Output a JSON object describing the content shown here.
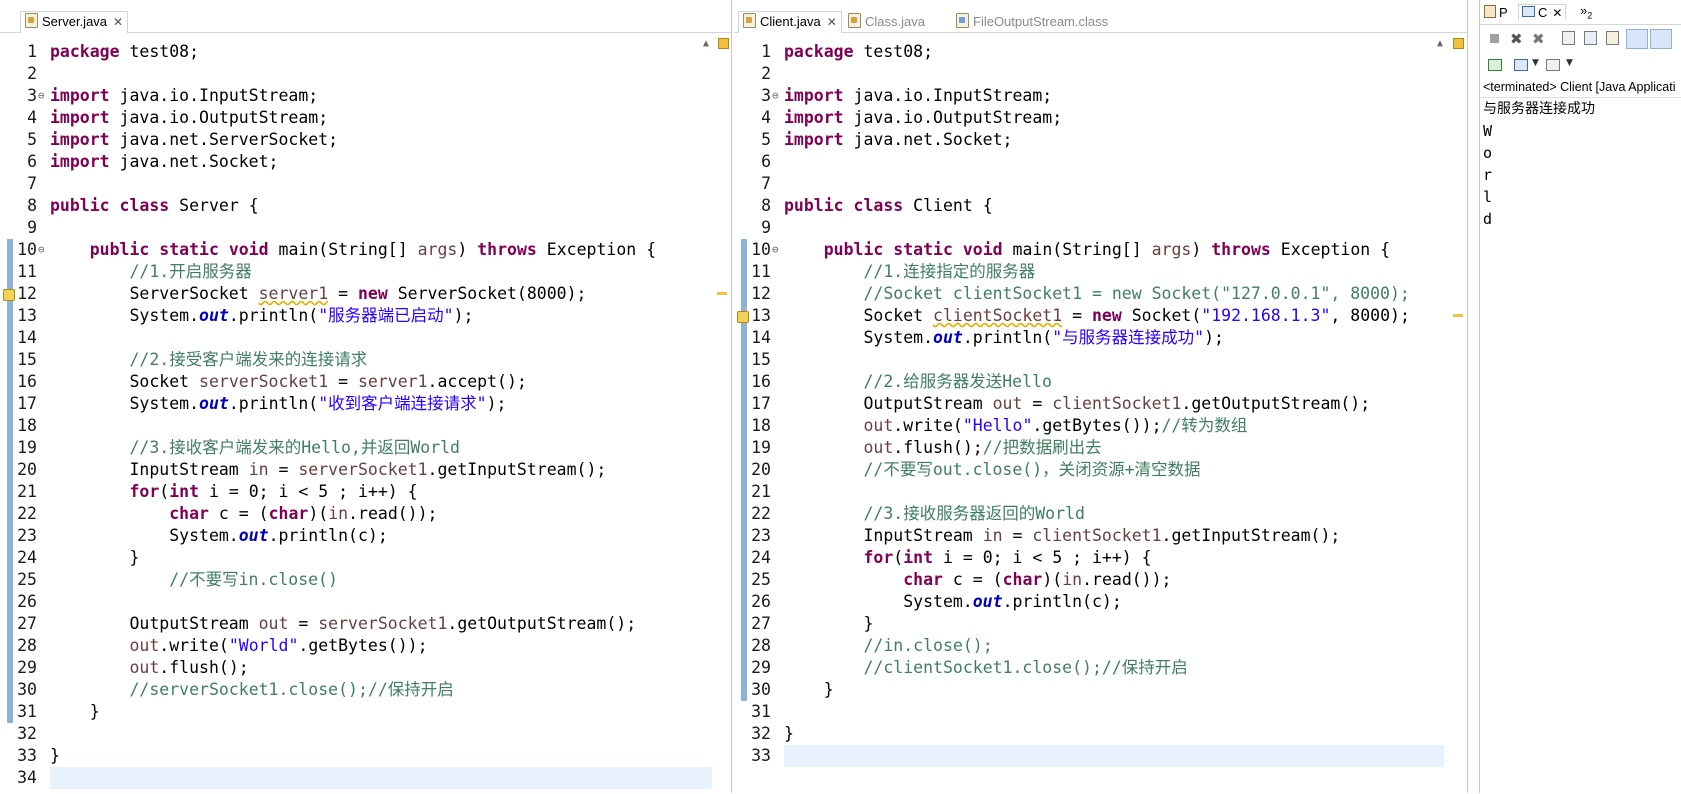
{
  "left_editor": {
    "tabs": [
      {
        "label": "Server.java",
        "active": true
      }
    ],
    "lines": [
      [
        [
          "kw",
          "package"
        ],
        [
          "p",
          " test08;"
        ]
      ],
      [],
      [
        [
          "kw",
          "import"
        ],
        [
          "p",
          " java.io.InputStream;"
        ]
      ],
      [
        [
          "kw",
          "import"
        ],
        [
          "p",
          " java.io.OutputStream;"
        ]
      ],
      [
        [
          "kw",
          "import"
        ],
        [
          "p",
          " java.net.ServerSocket;"
        ]
      ],
      [
        [
          "kw",
          "import"
        ],
        [
          "p",
          " java.net.Socket;"
        ]
      ],
      [],
      [
        [
          "kw",
          "public"
        ],
        [
          "p",
          " "
        ],
        [
          "kw",
          "class"
        ],
        [
          "p",
          " Server {"
        ]
      ],
      [],
      [
        [
          "p",
          "    "
        ],
        [
          "kw",
          "public"
        ],
        [
          "p",
          " "
        ],
        [
          "kw",
          "static"
        ],
        [
          "p",
          " "
        ],
        [
          "kw",
          "void"
        ],
        [
          "p",
          " main(String[] "
        ],
        [
          "var",
          "args"
        ],
        [
          "p",
          ") "
        ],
        [
          "kw",
          "throws"
        ],
        [
          "p",
          " Exception {"
        ]
      ],
      [
        [
          "p",
          "        "
        ],
        [
          "cm",
          "//1.开启服务器"
        ]
      ],
      [
        [
          "p",
          "        ServerSocket "
        ],
        [
          "warnvar",
          "server1"
        ],
        [
          "p",
          " = "
        ],
        [
          "kw",
          "new"
        ],
        [
          "p",
          " ServerSocket(8000);"
        ]
      ],
      [
        [
          "p",
          "        System."
        ],
        [
          "fld",
          "out"
        ],
        [
          "p",
          ".println("
        ],
        [
          "str",
          "\"服务器端已启动\""
        ],
        [
          "p",
          ");"
        ]
      ],
      [],
      [
        [
          "p",
          "        "
        ],
        [
          "cm",
          "//2.接受客户端发来的连接请求"
        ]
      ],
      [
        [
          "p",
          "        Socket "
        ],
        [
          "var",
          "serverSocket1"
        ],
        [
          "p",
          " = "
        ],
        [
          "var",
          "server1"
        ],
        [
          "p",
          ".accept();"
        ]
      ],
      [
        [
          "p",
          "        System."
        ],
        [
          "fld",
          "out"
        ],
        [
          "p",
          ".println("
        ],
        [
          "str",
          "\"收到客户端连接请求\""
        ],
        [
          "p",
          ");"
        ]
      ],
      [],
      [
        [
          "p",
          "        "
        ],
        [
          "cm",
          "//3.接收客户端发来的Hello,并返回World"
        ]
      ],
      [
        [
          "p",
          "        InputStream "
        ],
        [
          "var",
          "in"
        ],
        [
          "p",
          " = "
        ],
        [
          "var",
          "serverSocket1"
        ],
        [
          "p",
          ".getInputStream();"
        ]
      ],
      [
        [
          "p",
          "        "
        ],
        [
          "kw",
          "for"
        ],
        [
          "p",
          "("
        ],
        [
          "kw",
          "int"
        ],
        [
          "p",
          " i = 0; i < 5 ; i++) {"
        ]
      ],
      [
        [
          "p",
          "            "
        ],
        [
          "kw",
          "char"
        ],
        [
          "p",
          " c = ("
        ],
        [
          "kw",
          "char"
        ],
        [
          "p",
          ")("
        ],
        [
          "var",
          "in"
        ],
        [
          "p",
          ".read());"
        ]
      ],
      [
        [
          "p",
          "            System."
        ],
        [
          "fld",
          "out"
        ],
        [
          "p",
          ".println(c);"
        ]
      ],
      [
        [
          "p",
          "        }"
        ]
      ],
      [
        [
          "p",
          "            "
        ],
        [
          "cm",
          "//不要写in.close()"
        ]
      ],
      [],
      [
        [
          "p",
          "        OutputStream "
        ],
        [
          "var",
          "out"
        ],
        [
          "p",
          " = "
        ],
        [
          "var",
          "serverSocket1"
        ],
        [
          "p",
          ".getOutputStream();"
        ]
      ],
      [
        [
          "p",
          "        "
        ],
        [
          "var",
          "out"
        ],
        [
          "p",
          ".write("
        ],
        [
          "str",
          "\"World\""
        ],
        [
          "p",
          ".getBytes());"
        ]
      ],
      [
        [
          "p",
          "        "
        ],
        [
          "var",
          "out"
        ],
        [
          "p",
          ".flush();"
        ]
      ],
      [
        [
          "p",
          "        "
        ],
        [
          "cm",
          "//serverSocket1.close();//保持开启"
        ]
      ],
      [
        [
          "p",
          "    }"
        ]
      ],
      [],
      [
        [
          "p",
          "}"
        ]
      ],
      []
    ]
  },
  "right_editor": {
    "tabs": [
      {
        "label": "Client.java",
        "active": true
      },
      {
        "label": "Class.java",
        "active": false
      },
      {
        "label": "FileOutputStream.class",
        "active": false
      }
    ],
    "lines": [
      [
        [
          "kw",
          "package"
        ],
        [
          "p",
          " test08;"
        ]
      ],
      [],
      [
        [
          "kw",
          "import"
        ],
        [
          "p",
          " java.io.InputStream;"
        ]
      ],
      [
        [
          "kw",
          "import"
        ],
        [
          "p",
          " java.io.OutputStream;"
        ]
      ],
      [
        [
          "kw",
          "import"
        ],
        [
          "p",
          " java.net.Socket;"
        ]
      ],
      [],
      [],
      [
        [
          "kw",
          "public"
        ],
        [
          "p",
          " "
        ],
        [
          "kw",
          "class"
        ],
        [
          "p",
          " Client {"
        ]
      ],
      [],
      [
        [
          "p",
          "    "
        ],
        [
          "kw",
          "public"
        ],
        [
          "p",
          " "
        ],
        [
          "kw",
          "static"
        ],
        [
          "p",
          " "
        ],
        [
          "kw",
          "void"
        ],
        [
          "p",
          " main(String[] "
        ],
        [
          "var",
          "args"
        ],
        [
          "p",
          ") "
        ],
        [
          "kw",
          "throws"
        ],
        [
          "p",
          " Exception {"
        ]
      ],
      [
        [
          "p",
          "        "
        ],
        [
          "cm",
          "//1.连接指定的服务器"
        ]
      ],
      [
        [
          "p",
          "        "
        ],
        [
          "cm",
          "//Socket clientSocket1 = new Socket(\"127.0.0.1\", 8000);"
        ]
      ],
      [
        [
          "p",
          "        Socket "
        ],
        [
          "warnvar",
          "clientSocket1"
        ],
        [
          "p",
          " = "
        ],
        [
          "kw",
          "new"
        ],
        [
          "p",
          " Socket("
        ],
        [
          "str",
          "\"192.168.1.3\""
        ],
        [
          "p",
          ", 8000);"
        ]
      ],
      [
        [
          "p",
          "        System."
        ],
        [
          "fld",
          "out"
        ],
        [
          "p",
          ".println("
        ],
        [
          "str",
          "\"与服务器连接成功\""
        ],
        [
          "p",
          ");"
        ]
      ],
      [],
      [
        [
          "p",
          "        "
        ],
        [
          "cm",
          "//2.给服务器发送Hello"
        ]
      ],
      [
        [
          "p",
          "        OutputStream "
        ],
        [
          "var",
          "out"
        ],
        [
          "p",
          " = "
        ],
        [
          "var",
          "clientSocket1"
        ],
        [
          "p",
          ".getOutputStream();"
        ]
      ],
      [
        [
          "p",
          "        "
        ],
        [
          "var",
          "out"
        ],
        [
          "p",
          ".write("
        ],
        [
          "str",
          "\"Hello\""
        ],
        [
          "p",
          ".getBytes());"
        ],
        [
          "cm",
          "//转为数组"
        ]
      ],
      [
        [
          "p",
          "        "
        ],
        [
          "var",
          "out"
        ],
        [
          "p",
          ".flush();"
        ],
        [
          "cm",
          "//把数据刷出去"
        ]
      ],
      [
        [
          "p",
          "        "
        ],
        [
          "cm",
          "//不要写out.close()，关闭资源+清空数据"
        ]
      ],
      [],
      [
        [
          "p",
          "        "
        ],
        [
          "cm",
          "//3.接收服务器返回的World"
        ]
      ],
      [
        [
          "p",
          "        InputStream "
        ],
        [
          "var",
          "in"
        ],
        [
          "p",
          " = "
        ],
        [
          "var",
          "clientSocket1"
        ],
        [
          "p",
          ".getInputStream();"
        ]
      ],
      [
        [
          "p",
          "        "
        ],
        [
          "kw",
          "for"
        ],
        [
          "p",
          "("
        ],
        [
          "kw",
          "int"
        ],
        [
          "p",
          " i = 0; i < 5 ; i++) {"
        ]
      ],
      [
        [
          "p",
          "            "
        ],
        [
          "kw",
          "char"
        ],
        [
          "p",
          " c = ("
        ],
        [
          "kw",
          "char"
        ],
        [
          "p",
          ")("
        ],
        [
          "var",
          "in"
        ],
        [
          "p",
          ".read());"
        ]
      ],
      [
        [
          "p",
          "            System."
        ],
        [
          "fld",
          "out"
        ],
        [
          "p",
          ".println(c);"
        ]
      ],
      [
        [
          "p",
          "        }"
        ]
      ],
      [
        [
          "p",
          "        "
        ],
        [
          "cm",
          "//in.close();"
        ]
      ],
      [
        [
          "p",
          "        "
        ],
        [
          "cm",
          "//clientSocket1.close();//保持开启"
        ]
      ],
      [
        [
          "p",
          "    }"
        ]
      ],
      [],
      [
        [
          "p",
          "}"
        ]
      ],
      []
    ]
  },
  "console": {
    "tab_labels": [
      "P",
      "C",
      "»",
      "2"
    ],
    "status": "<terminated> Client [Java Applicati",
    "output": [
      "与服务器连接成功",
      "W",
      "o",
      "r",
      "l",
      "d"
    ]
  },
  "colors": {
    "keyword": "#7f0055",
    "string": "#2a00ff",
    "comment": "#3f7f5f",
    "field": "#0000c0",
    "local_var": "#6a3e3e",
    "current_line": "#e8f2fe",
    "change_ruler": "#8fb0d9"
  }
}
